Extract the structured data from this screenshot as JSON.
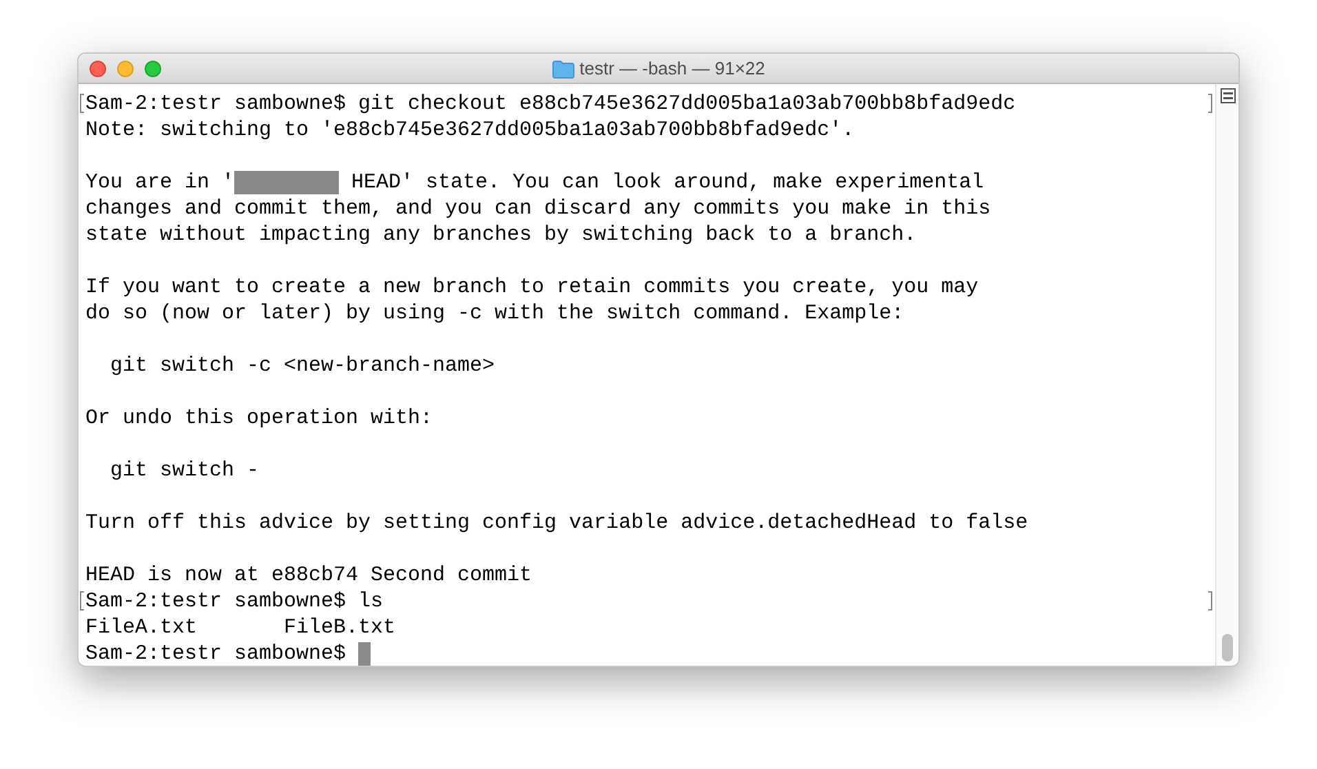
{
  "window": {
    "title": "testr — -bash — 91×22"
  },
  "lines": [
    {
      "kind": "text",
      "text": "Sam-2:testr sambowne$ git checkout e88cb745e3627dd005ba1a03ab700bb8bfad9edc",
      "marked": true,
      "cursor": false
    },
    {
      "kind": "text",
      "text": "Note: switching to 'e88cb745e3627dd005ba1a03ab700bb8bfad9edc'.",
      "marked": false,
      "cursor": false
    },
    {
      "kind": "blank"
    },
    {
      "kind": "redacted",
      "before": "You are in '",
      "after": " HEAD' state. You can look around, make experimental",
      "marked": false,
      "cursor": false
    },
    {
      "kind": "text",
      "text": "changes and commit them, and you can discard any commits you make in this",
      "marked": false,
      "cursor": false
    },
    {
      "kind": "text",
      "text": "state without impacting any branches by switching back to a branch.",
      "marked": false,
      "cursor": false
    },
    {
      "kind": "blank"
    },
    {
      "kind": "text",
      "text": "If you want to create a new branch to retain commits you create, you may",
      "marked": false,
      "cursor": false
    },
    {
      "kind": "text",
      "text": "do so (now or later) by using -c with the switch command. Example:",
      "marked": false,
      "cursor": false
    },
    {
      "kind": "blank"
    },
    {
      "kind": "text",
      "text": "  git switch -c <new-branch-name>",
      "marked": false,
      "cursor": false
    },
    {
      "kind": "blank"
    },
    {
      "kind": "text",
      "text": "Or undo this operation with:",
      "marked": false,
      "cursor": false
    },
    {
      "kind": "blank"
    },
    {
      "kind": "text",
      "text": "  git switch -",
      "marked": false,
      "cursor": false
    },
    {
      "kind": "blank"
    },
    {
      "kind": "text",
      "text": "Turn off this advice by setting config variable advice.detachedHead to false",
      "marked": false,
      "cursor": false
    },
    {
      "kind": "blank"
    },
    {
      "kind": "text",
      "text": "HEAD is now at e88cb74 Second commit",
      "marked": false,
      "cursor": false
    },
    {
      "kind": "text",
      "text": "Sam-2:testr sambowne$ ls",
      "marked": true,
      "cursor": false
    },
    {
      "kind": "text",
      "text": "FileA.txt       FileB.txt",
      "marked": false,
      "cursor": false
    },
    {
      "kind": "text",
      "text": "Sam-2:testr sambowne$ ",
      "marked": false,
      "cursor": true
    }
  ]
}
